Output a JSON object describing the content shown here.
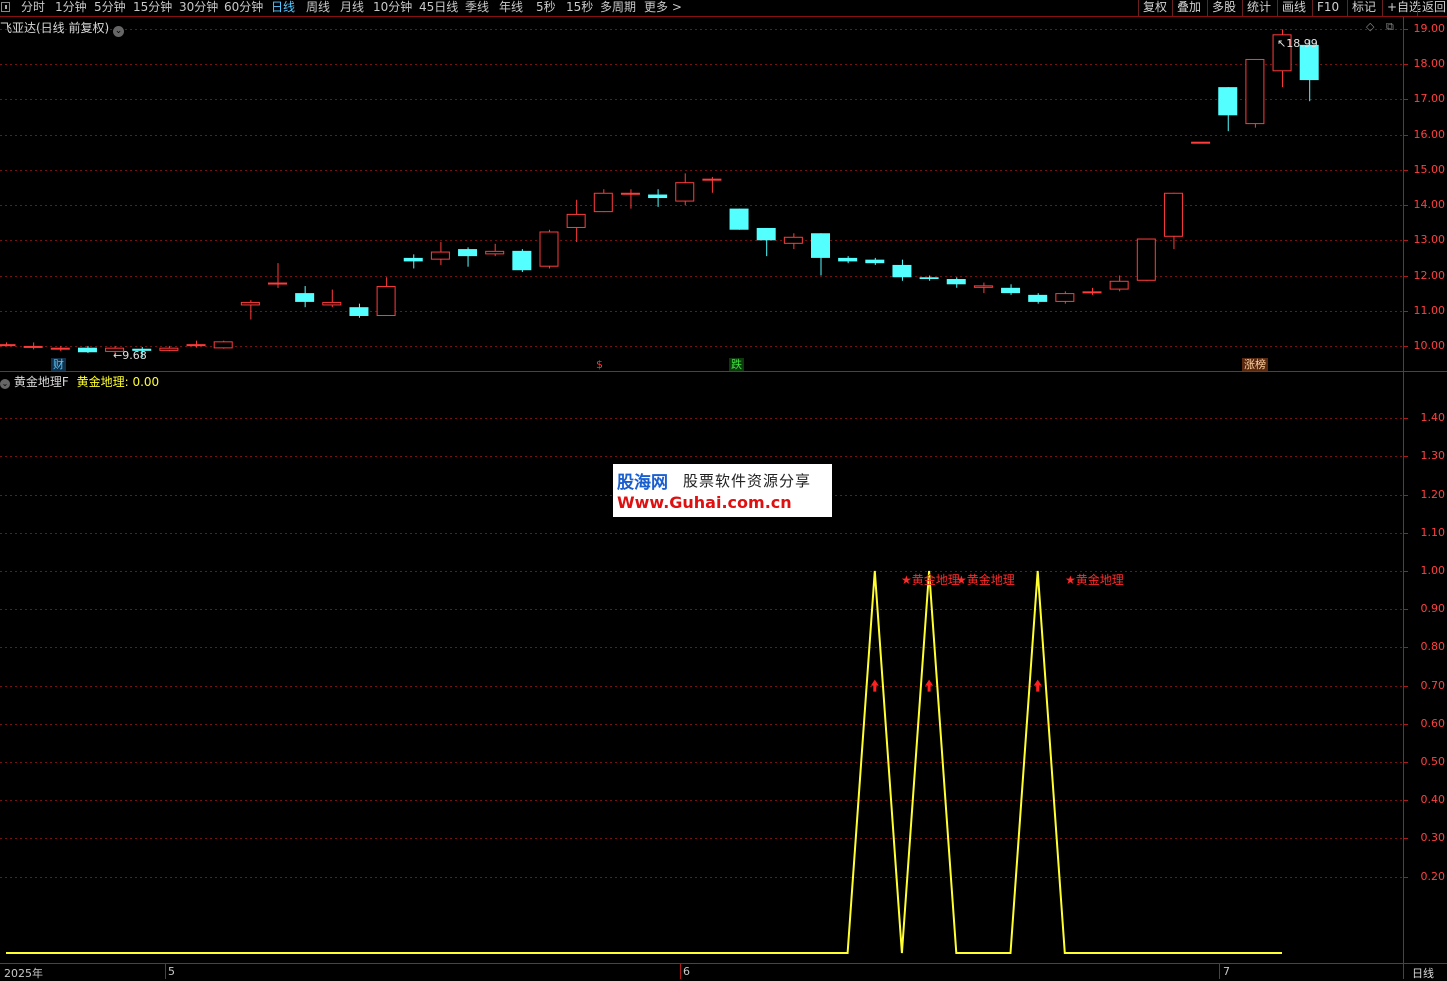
{
  "toolbar": {
    "periods": [
      "分时",
      "1分钟",
      "5分钟",
      "15分钟",
      "30分钟",
      "60分钟",
      "日线",
      "周线",
      "月线",
      "10分钟",
      "45日线",
      "季线",
      "年线",
      "5秒",
      "15秒",
      "多周期",
      "更多 >"
    ],
    "active": "日线",
    "right": [
      "复权",
      "叠加",
      "多股",
      "统计",
      "画线",
      "F10",
      "标记",
      "+自选",
      "返回"
    ]
  },
  "main_panel": {
    "title": "飞亚达(日线 前复权)",
    "y_ticks": [
      "19.00",
      "18.00",
      "17.00",
      "16.00",
      "15.00",
      "14.00",
      "13.00",
      "12.00",
      "11.00",
      "10.00"
    ],
    "high_label": "18.99",
    "low_label": "9.68",
    "markers": [
      {
        "text": "财",
        "color": "#56c8ff"
      },
      {
        "text": "$",
        "color": "#ff3030"
      },
      {
        "text": "跌",
        "color": "#40e040"
      },
      {
        "text": "涨榜",
        "color": "#ffd0a0"
      }
    ]
  },
  "indicator_panel": {
    "name": "黄金地理F",
    "series_label": "黄金地理",
    "series_value": "0.00",
    "y_ticks": [
      "1.40",
      "1.30",
      "1.20",
      "1.10",
      "1.00",
      "0.90",
      "0.80",
      "0.70",
      "0.60",
      "0.50",
      "0.40",
      "0.30",
      "0.20"
    ],
    "peak_labels": [
      "★黄金地理",
      "★黄金地理",
      "★黄金地理"
    ]
  },
  "watermark": {
    "logo": "股海网",
    "slogan": "股票软件资源分享",
    "url": "Www.Guhai.com.cn"
  },
  "date_axis": {
    "labels": [
      "2025年",
      "5",
      "6",
      "7"
    ],
    "period_label": "日线"
  },
  "colors": {
    "up": "#ff3c3c",
    "down": "#54ffff",
    "indicator_line": "#ffff30",
    "grid": "#7a1010"
  },
  "chart_data": [
    {
      "type": "candlestick",
      "title": "飞亚达(日线 前复权)",
      "ylim": [
        9.6,
        19.2
      ],
      "candles": [
        {
          "o": 10.05,
          "c": 10.05,
          "h": 10.1,
          "l": 10.0
        },
        {
          "o": 10.0,
          "c": 10.0,
          "h": 10.1,
          "l": 9.9
        },
        {
          "o": 9.9,
          "c": 9.95,
          "h": 10.0,
          "l": 9.85
        },
        {
          "o": 9.95,
          "c": 9.82,
          "h": 10.0,
          "l": 9.8
        },
        {
          "o": 9.83,
          "c": 9.95,
          "h": 10.0,
          "l": 9.7
        },
        {
          "o": 9.92,
          "c": 9.86,
          "h": 9.97,
          "l": 9.68
        },
        {
          "o": 9.86,
          "c": 9.95,
          "h": 10.0,
          "l": 9.85
        },
        {
          "o": 10.05,
          "c": 10.05,
          "h": 10.15,
          "l": 9.95
        },
        {
          "o": 9.93,
          "c": 10.13,
          "h": 10.15,
          "l": 9.92
        },
        {
          "o": 11.15,
          "c": 11.25,
          "h": 11.3,
          "l": 10.75
        },
        {
          "o": 11.75,
          "c": 11.8,
          "h": 12.35,
          "l": 11.65
        },
        {
          "o": 11.5,
          "c": 11.25,
          "h": 11.7,
          "l": 11.1
        },
        {
          "o": 11.15,
          "c": 11.25,
          "h": 11.6,
          "l": 11.1
        },
        {
          "o": 11.1,
          "c": 10.85,
          "h": 11.2,
          "l": 10.8
        },
        {
          "o": 10.85,
          "c": 11.7,
          "h": 11.95,
          "l": 10.85
        },
        {
          "o": 12.5,
          "c": 12.4,
          "h": 12.6,
          "l": 12.2
        },
        {
          "o": 12.45,
          "c": 12.68,
          "h": 12.95,
          "l": 12.3
        },
        {
          "o": 12.75,
          "c": 12.55,
          "h": 12.8,
          "l": 12.25
        },
        {
          "o": 12.6,
          "c": 12.7,
          "h": 12.9,
          "l": 12.55
        },
        {
          "o": 12.7,
          "c": 12.15,
          "h": 12.75,
          "l": 12.1
        },
        {
          "o": 12.25,
          "c": 13.25,
          "h": 13.3,
          "l": 12.2
        },
        {
          "o": 13.35,
          "c": 13.75,
          "h": 14.15,
          "l": 12.95
        },
        {
          "o": 13.8,
          "c": 14.35,
          "h": 14.45,
          "l": 13.8
        },
        {
          "o": 14.3,
          "c": 14.35,
          "h": 14.45,
          "l": 13.9
        },
        {
          "o": 14.3,
          "c": 14.2,
          "h": 14.45,
          "l": 13.95
        },
        {
          "o": 14.1,
          "c": 14.65,
          "h": 14.9,
          "l": 14.0
        },
        {
          "o": 14.7,
          "c": 14.75,
          "h": 14.8,
          "l": 14.35
        },
        {
          "o": 13.9,
          "c": 13.3,
          "h": 13.9,
          "l": 13.3
        },
        {
          "o": 13.35,
          "c": 13.0,
          "h": 13.35,
          "l": 12.55
        },
        {
          "o": 12.9,
          "c": 13.1,
          "h": 13.2,
          "l": 12.75
        },
        {
          "o": 13.2,
          "c": 12.5,
          "h": 13.2,
          "l": 12.0
        },
        {
          "o": 12.5,
          "c": 12.4,
          "h": 12.55,
          "l": 12.35
        },
        {
          "o": 12.45,
          "c": 12.35,
          "h": 12.5,
          "l": 12.3
        },
        {
          "o": 12.3,
          "c": 11.95,
          "h": 12.45,
          "l": 11.85
        },
        {
          "o": 11.95,
          "c": 11.9,
          "h": 12.0,
          "l": 11.85
        },
        {
          "o": 11.9,
          "c": 11.75,
          "h": 11.95,
          "l": 11.65
        },
        {
          "o": 11.65,
          "c": 11.72,
          "h": 11.8,
          "l": 11.5
        },
        {
          "o": 11.65,
          "c": 11.5,
          "h": 11.75,
          "l": 11.45
        },
        {
          "o": 11.45,
          "c": 11.25,
          "h": 11.5,
          "l": 11.2
        },
        {
          "o": 11.25,
          "c": 11.5,
          "h": 11.55,
          "l": 11.2
        },
        {
          "o": 11.55,
          "c": 11.55,
          "h": 11.65,
          "l": 11.45
        },
        {
          "o": 11.6,
          "c": 11.85,
          "h": 12.0,
          "l": 11.55
        },
        {
          "o": 11.85,
          "c": 13.05,
          "h": 13.05,
          "l": 11.85
        },
        {
          "o": 13.1,
          "c": 14.35,
          "h": 14.35,
          "l": 12.75
        },
        {
          "o": 15.8,
          "c": 15.8,
          "h": 15.8,
          "l": 15.8
        },
        {
          "o": 17.35,
          "c": 16.55,
          "h": 17.35,
          "l": 16.1
        },
        {
          "o": 16.3,
          "c": 18.15,
          "h": 18.15,
          "l": 16.2
        },
        {
          "o": 17.8,
          "c": 18.85,
          "h": 18.99,
          "l": 17.35
        },
        {
          "o": 18.55,
          "c": 17.55,
          "h": 18.7,
          "l": 16.95
        }
      ]
    },
    {
      "type": "line",
      "name": "黄金地理",
      "ylim": [
        0,
        1.5
      ],
      "values": [
        0,
        0,
        0,
        0,
        0,
        0,
        0,
        0,
        0,
        0,
        0,
        0,
        0,
        0,
        0,
        0,
        0,
        0,
        0,
        0,
        0,
        0,
        0,
        0,
        0,
        0,
        0,
        0,
        0,
        0,
        0,
        0,
        1,
        0,
        1,
        0,
        0,
        0,
        1,
        0,
        0,
        0,
        0,
        0,
        0,
        0,
        0,
        0
      ],
      "x_start_index": 0
    }
  ]
}
